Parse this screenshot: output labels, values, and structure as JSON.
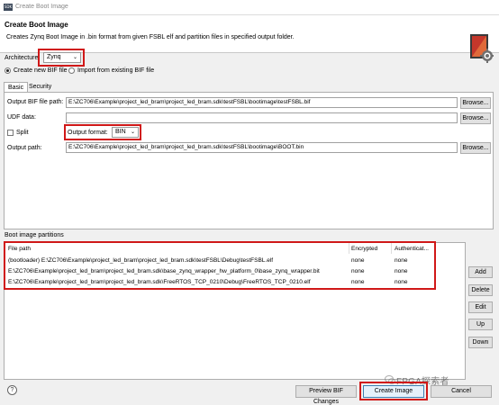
{
  "window": {
    "app_icon": "SDK",
    "title": "Create Boot Image"
  },
  "header": {
    "title": "Create Boot Image",
    "description": "Creates Zynq Boot Image in .bin format from given FSBL elf and partition files in specified output folder."
  },
  "architecture": {
    "label": "Architecture:",
    "value": "Zynq"
  },
  "bif_mode": {
    "create_new": "Create new BIF file",
    "import_existing": "Import from existing BIF file",
    "selected": "create_new"
  },
  "tabs": [
    {
      "label": "Basic",
      "active": true
    },
    {
      "label": "Security",
      "active": false
    }
  ],
  "basic": {
    "output_bif_label": "Output BIF file path:",
    "output_bif_value": "E:\\ZC706\\Example\\project_led_bram\\project_led_bram.sdk\\testFSBL\\bootimage\\testFSBL.bif",
    "udf_label": "UDF data:",
    "udf_value": "",
    "split_label": "Split",
    "output_format_label": "Output format:",
    "output_format_value": "BIN",
    "output_path_label": "Output path:",
    "output_path_value": "E:\\ZC706\\Example\\project_led_bram\\project_led_bram.sdk\\testFSBL\\bootimage\\BOOT.bin",
    "browse_label": "Browse..."
  },
  "partitions": {
    "section_label": "Boot image partitions",
    "columns": [
      "File path",
      "Encrypted",
      "Authenticat..."
    ],
    "rows": [
      [
        "(bootloader) E:\\ZC706\\Example\\project_led_bram\\project_led_bram.sdk\\testFSBL\\Debug\\testFSBL.elf",
        "none",
        "none"
      ],
      [
        "E:\\ZC706\\Example\\project_led_bram\\project_led_bram.sdk\\base_zynq_wrapper_hw_platform_0\\base_zynq_wrapper.bit",
        "none",
        "none"
      ],
      [
        "E:\\ZC706\\Example\\project_led_bram\\project_led_bram.sdk\\FreeRTOS_TCP_0210\\Debug\\FreeRTOS_TCP_0210.elf",
        "none",
        "none"
      ]
    ],
    "buttons": {
      "add": "Add",
      "delete": "Delete",
      "edit": "Edit",
      "up": "Up",
      "down": "Down"
    }
  },
  "footer": {
    "help": "?",
    "preview": "Preview BIF Changes",
    "create": "Create Image",
    "cancel": "Cancel",
    "watermark": "FPGA探索者"
  },
  "colors": {
    "highlight": "#d01818",
    "primary_border": "#3c7fb1"
  }
}
